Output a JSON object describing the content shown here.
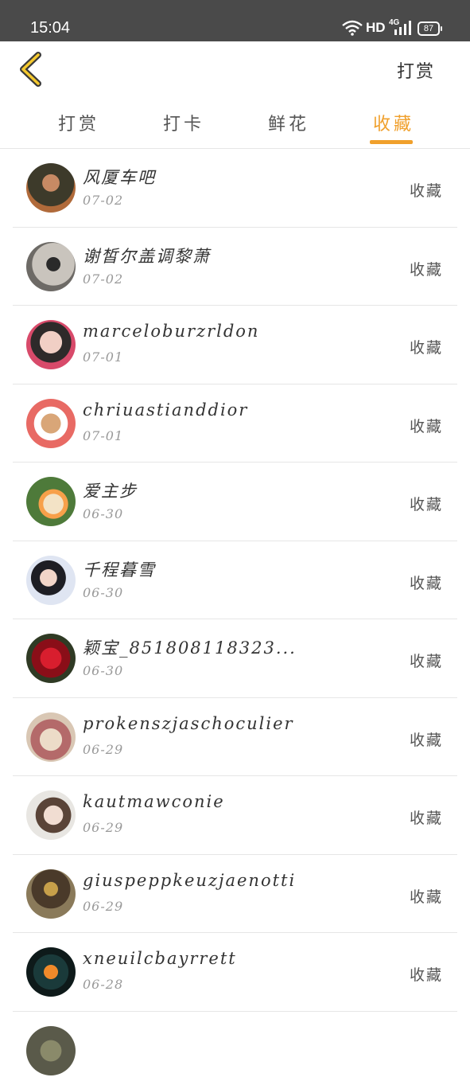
{
  "status_bar": {
    "time": "15:04",
    "network": "HD",
    "network_type": "4G",
    "battery": "87"
  },
  "header": {
    "back_icon": "chevron-left-icon",
    "action_label": "打赏"
  },
  "tabs": [
    {
      "label": "打赏",
      "active": false
    },
    {
      "label": "打卡",
      "active": false
    },
    {
      "label": "鲜花",
      "active": false
    },
    {
      "label": "收藏",
      "active": true
    }
  ],
  "colors": {
    "accent": "#f0a02c",
    "status_bar": "#4a4a4a",
    "divider": "#e6e6e6"
  },
  "records": [
    {
      "name": "风厦车吧",
      "date": "07-02",
      "type": "收藏"
    },
    {
      "name": "谢皙尔盖调黎萧",
      "date": "07-02",
      "type": "收藏"
    },
    {
      "name": "marceloburzrldon",
      "date": "07-01",
      "type": "收藏"
    },
    {
      "name": "chriuastianddior",
      "date": "07-01",
      "type": "收藏"
    },
    {
      "name": "爱主步",
      "date": "06-30",
      "type": "收藏"
    },
    {
      "name": "千程暮雪",
      "date": "06-30",
      "type": "收藏"
    },
    {
      "name": "颖宝_851808118323...",
      "date": "06-30",
      "type": "收藏"
    },
    {
      "name": "prokenszjaschoculier",
      "date": "06-29",
      "type": "收藏"
    },
    {
      "name": "kautmawconie",
      "date": "06-29",
      "type": "收藏"
    },
    {
      "name": "giuspeppkeuzjaenotti",
      "date": "06-29",
      "type": "收藏"
    },
    {
      "name": "xneuilcbayrrett",
      "date": "06-28",
      "type": "收藏"
    },
    {
      "name": "",
      "date": "",
      "type": ""
    }
  ]
}
